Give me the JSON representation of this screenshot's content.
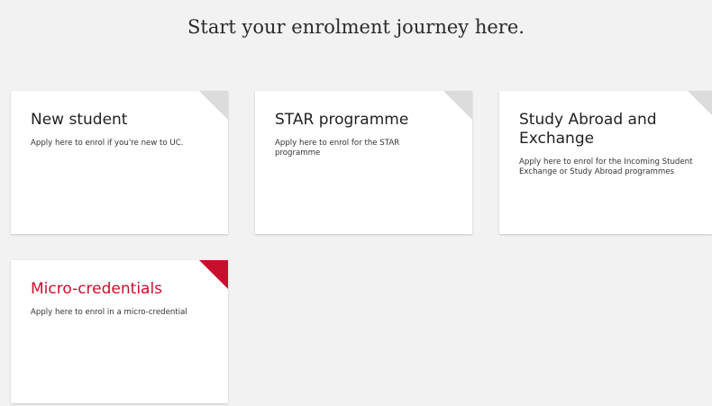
{
  "header": {
    "title": "Start your enrolment journey here."
  },
  "cards": [
    {
      "title": "New student",
      "description": "Apply here to enrol if you're new to UC."
    },
    {
      "title": "STAR programme",
      "description": "Apply here to enrol for the STAR programme"
    },
    {
      "title": "Study Abroad and Exchange",
      "description": "Apply here to enrol for the Incoming Student Exchange or Study Abroad programmes"
    },
    {
      "title": "Micro-credentials",
      "description": "Apply here to enrol in a micro-credential"
    }
  ],
  "colors": {
    "accent": "#c8102e",
    "corner_default": "#dcdcdc",
    "background": "#f2f2f2"
  },
  "icons": {
    "card_corner": "corner-arrow-icon"
  }
}
